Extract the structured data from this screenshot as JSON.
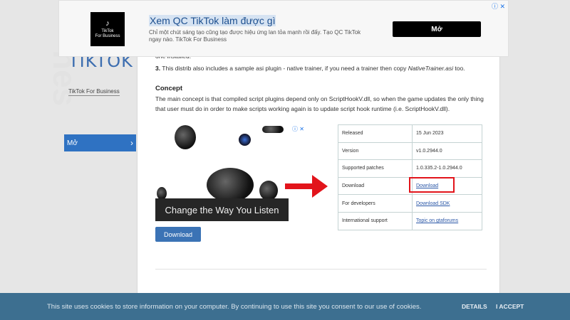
{
  "ad": {
    "logo_text": "TikTok\nFor Business",
    "title": "Xem QC TikTok làm được gì",
    "description": "Chỉ một chút sáng tạo cũng tạo được hiệu ứng lan tỏa mạnh rồi đấy. Tạo QC TikTok ngay nào. TikTok For Business",
    "button": "Mở",
    "icons": "ⓘ ✕"
  },
  "sidebar": {
    "logo": "TIKTOK",
    "logo_sub": "TikTok For Business",
    "watermark": "nes",
    "button_label": "Mở",
    "button_icon": "chevron-right-icon"
  },
  "article": {
    "line_installed": "one installed.",
    "step3_num": "3.",
    "step3_text": " This distrib also includes a sample asi plugin - native trainer, if you need a trainer then copy ",
    "step3_file": "NativeTrainer.asi",
    "step3_end": " too.",
    "concept_heading": "Concept",
    "concept_text": "The main concept is that compiled script plugins depend only on ScriptHookV.dll, so when the game updates the only thing that user must do in order to make scripts working again is to update script hook runtime (i.e. ScriptHookV.dll)."
  },
  "image_ad": {
    "icons": "ⓘ ✕",
    "caption": "Change the Way You Listen",
    "button": "Download"
  },
  "info_table": {
    "rows": [
      {
        "key": "Released",
        "value": "15 Jun 2023",
        "link": false
      },
      {
        "key": "Version",
        "value": "v1.0.2944.0",
        "link": false
      },
      {
        "key": "Supported patches",
        "value": "1.0.335.2-1.0.2944.0",
        "link": false
      },
      {
        "key": "Download",
        "value": "Download",
        "link": true
      },
      {
        "key": "For developers",
        "value": "Download SDK",
        "link": true
      },
      {
        "key": "International support",
        "value": "Topic on gtaforums",
        "link": true
      }
    ]
  },
  "cookie": {
    "text": "This site uses cookies to store information on your computer. By continuing to use this site you consent to our use of cookies.",
    "details": "DETAILS",
    "accept": "I ACCEPT"
  },
  "colors": {
    "highlight": "#e2141b",
    "arrow": "#e2141b",
    "cookie_bar": "#3d6f90",
    "sidebar_button": "#2f72c2"
  }
}
